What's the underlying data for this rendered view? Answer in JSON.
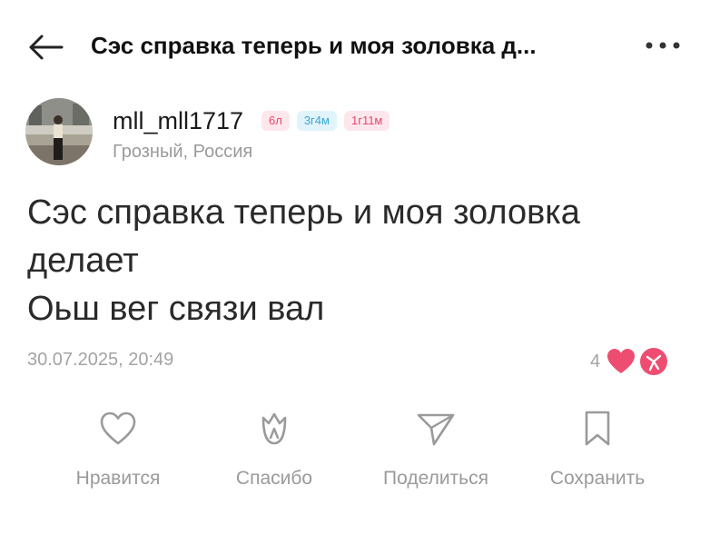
{
  "header": {
    "title": "Сэс справка теперь и моя золовка д...",
    "back_icon": "arrow-left-icon",
    "more_icon": "more-horizontal-icon"
  },
  "author": {
    "username": "mll_mll1717",
    "location": "Грозный, Россия",
    "badges": [
      "6л",
      "3г4м",
      "1г11м"
    ]
  },
  "post": {
    "text": "Сэс справка теперь и моя золовка\nделает\nОьш вег связи вал",
    "timestamp": "30.07.2025, 20:49",
    "reaction_count": "4"
  },
  "actions": [
    {
      "label": "Нравится",
      "icon": "heart-icon"
    },
    {
      "label": "Спасибо",
      "icon": "tulip-icon"
    },
    {
      "label": "Поделиться",
      "icon": "send-icon"
    },
    {
      "label": "Сохранить",
      "icon": "bookmark-icon"
    }
  ],
  "colors": {
    "reaction": "#ee4d72",
    "badge_pink": "#e8466e",
    "badge_blue": "#3aa6d0",
    "muted_text": "#9a9a9a"
  }
}
